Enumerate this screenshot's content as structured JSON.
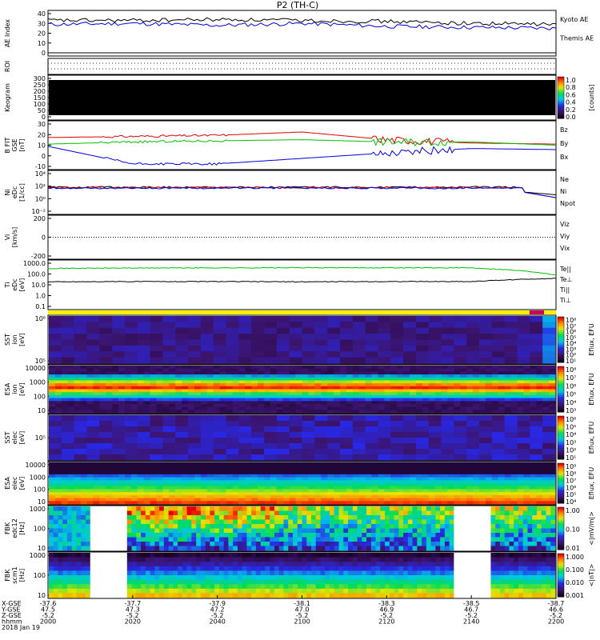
{
  "title": "P2 (TH-C)",
  "colors": {
    "blue": "#0000dd",
    "red": "#dd0000",
    "green": "#00c000",
    "black": "#000000",
    "yellow": "#ffee00",
    "magenta": "#cc0055",
    "purple_bg": "#2a0a4a"
  },
  "panels": [
    {
      "id": "ae",
      "ylabel": "AE Index",
      "yticks": [
        "40",
        "30",
        "20",
        "10",
        "0"
      ],
      "legend": [
        {
          "text": "Kyoto AE",
          "color": "#0000dd"
        },
        {
          "text": "Themis AE",
          "color": "#000000"
        }
      ]
    },
    {
      "id": "roi",
      "ylabel": "ROI",
      "yticks": []
    },
    {
      "id": "keogram",
      "ylabel": "Keogram",
      "yticks": [
        "300",
        "250",
        "200",
        "150",
        "100",
        "50",
        "0"
      ],
      "colorbar": {
        "label": "[counts]",
        "ticks": [
          "1.0",
          "0.8",
          "0.6",
          "0.4",
          "0.2",
          "0.0"
        ]
      }
    },
    {
      "id": "bfgm",
      "ylabel": [
        "B FIT",
        "GSE",
        "[nT]"
      ],
      "yticks": [
        "30",
        "20",
        "10",
        "0",
        "-10"
      ],
      "legend": [
        {
          "text": "Bz",
          "color": "#dd0000"
        },
        {
          "text": "By",
          "color": "#00c000"
        },
        {
          "text": "Bx",
          "color": "#0000dd"
        }
      ]
    },
    {
      "id": "density",
      "ylabel": [
        "Ni",
        "eDc",
        "[1/cc]"
      ],
      "yticks": [
        "10⁴",
        "10²",
        "10⁰",
        "10⁻²"
      ],
      "legend": [
        {
          "text": "Ne",
          "color": "#dd0000"
        },
        {
          "text": "Ni",
          "color": "#000000"
        },
        {
          "text": "Npot",
          "color": "#0000dd"
        }
      ]
    },
    {
      "id": "velocity",
      "ylabel": [
        "Vi",
        "[km/s]"
      ],
      "yticks": [
        "200",
        "0",
        "-200"
      ],
      "legend": [
        {
          "text": "Viz",
          "color": "#dd0000"
        },
        {
          "text": "Viy",
          "color": "#00c000"
        },
        {
          "text": "Vix",
          "color": "#0000dd"
        }
      ]
    },
    {
      "id": "temperature",
      "ylabel": [
        "Ti",
        "eDc",
        "[eV]"
      ],
      "yticks": [
        "1000.0",
        "100.0",
        "10.0",
        "1.0",
        "0.1"
      ],
      "legend": [
        {
          "text": "Te||",
          "color": "#000000"
        },
        {
          "text": "Te⊥",
          "color": "#dd0000"
        },
        {
          "text": "Ti||",
          "color": "#00c000"
        },
        {
          "text": "Ti⊥",
          "color": "#0000dd"
        }
      ]
    },
    {
      "id": "sst_ion",
      "ylabel": [
        "SST",
        "ion",
        "[eV]"
      ],
      "yticks": [
        "10⁶",
        "10⁵"
      ],
      "colorbar": {
        "label": "Eflux, EFU",
        "ticks": [
          "10⁸",
          "10⁷",
          "10⁶",
          "10⁵",
          "10⁴",
          "10³",
          "10²",
          "10¹"
        ]
      }
    },
    {
      "id": "esa_ion",
      "ylabel": [
        "ESA",
        "ion",
        "[eV]"
      ],
      "yticks": [
        "10000",
        "1000",
        "100",
        "10"
      ],
      "colorbar": {
        "label": "Eflux, EFU",
        "ticks": [
          "10⁸",
          "10⁷",
          "10⁶",
          "10⁵",
          "10⁴",
          "10³"
        ]
      }
    },
    {
      "id": "sst_elec",
      "ylabel": [
        "SST",
        "elec",
        "[eV]"
      ],
      "yticks": [
        "10⁵"
      ],
      "colorbar": {
        "label": "Eflux, EFU",
        "ticks": [
          "10⁶",
          "10⁵",
          "10⁴",
          "10³",
          "10²",
          "10¹"
        ]
      }
    },
    {
      "id": "esa_elec",
      "ylabel": [
        "ESA",
        "elec",
        "[eV]"
      ],
      "yticks": [
        "10000",
        "1000",
        "100",
        "10"
      ],
      "colorbar": {
        "label": "Eflux, EFU",
        "ticks": [
          "10⁹",
          "10⁸",
          "10⁷",
          "10⁶",
          "10⁵",
          "10⁴"
        ]
      }
    },
    {
      "id": "fbk_edc12",
      "ylabel": [
        "FBK",
        "edc12",
        "[Hz]"
      ],
      "yticks": [
        "1000",
        "100",
        "10"
      ],
      "colorbar": {
        "label": "<|mV/m|>",
        "ticks": [
          "1.00",
          "0.10",
          "0.01"
        ]
      }
    },
    {
      "id": "fbk_scm1",
      "ylabel": [
        "FBK",
        "scm1",
        "[Hz]"
      ],
      "yticks": [
        "1000",
        "100",
        "10"
      ],
      "colorbar": {
        "label": "<|nT|>",
        "ticks": [
          "1.000",
          "0.100",
          "0.010",
          "0.001"
        ]
      }
    }
  ],
  "xaxis": {
    "row_labels": [
      "X-GSE",
      "Y-GSE",
      "Z-GSE",
      "hhmm",
      "2018 Jan 19"
    ],
    "ticks": [
      {
        "x": "-37.6",
        "y": "47.5",
        "z": "-5.2",
        "t": "2000"
      },
      {
        "x": "-37.7",
        "y": "47.3",
        "z": "-5.2",
        "t": "2020"
      },
      {
        "x": "-37.9",
        "y": "47.2",
        "z": "-5.2",
        "t": "2040"
      },
      {
        "x": "-38.1",
        "y": "47.0",
        "z": "-5.2",
        "t": "2100"
      },
      {
        "x": "-38.3",
        "y": "46.9",
        "z": "-5.2",
        "t": "2120"
      },
      {
        "x": "-38.5",
        "y": "46.7",
        "z": "-5.2",
        "t": "2140"
      },
      {
        "x": "-38.7",
        "y": "46.6",
        "z": "-5.2",
        "t": "2200"
      }
    ]
  },
  "chart_data": [
    {
      "type": "line",
      "panel": "ae",
      "ylabel": "AE Index",
      "ylim": [
        0,
        40
      ],
      "x": [
        "2000",
        "2020",
        "2040",
        "2100",
        "2120",
        "2140",
        "2200"
      ],
      "series": [
        {
          "name": "Kyoto AE",
          "color": "#0000dd",
          "values": [
            29,
            30,
            28,
            30,
            27,
            26,
            25
          ]
        },
        {
          "name": "Themis AE",
          "color": "#000000",
          "values": [
            33,
            33,
            34,
            33,
            32,
            30,
            29
          ]
        }
      ]
    },
    {
      "type": "line",
      "panel": "bfgm",
      "ylabel": "B FIT GSE [nT]",
      "ylim": [
        -10,
        30
      ],
      "x": [
        "2000",
        "2020",
        "2040",
        "2100",
        "2120",
        "2140",
        "2200"
      ],
      "series": [
        {
          "name": "Bz",
          "color": "#dd0000",
          "values": [
            17,
            18,
            19,
            22,
            15,
            12,
            11
          ]
        },
        {
          "name": "By",
          "color": "#00c000",
          "values": [
            11,
            13,
            14,
            15,
            13,
            13,
            10
          ]
        },
        {
          "name": "Bx",
          "color": "#0000dd",
          "values": [
            9,
            -7,
            -7,
            -2,
            3,
            7,
            6
          ]
        }
      ]
    },
    {
      "type": "line",
      "panel": "temperature",
      "ylabel": "Ti eDc [eV]",
      "ylim": [
        0.1,
        1000
      ],
      "x": [
        "2000",
        "2020",
        "2040",
        "2100",
        "2120",
        "2140",
        "2200"
      ],
      "series": [
        {
          "name": "Ti||",
          "color": "#00c000",
          "values": [
            330,
            360,
            370,
            380,
            380,
            370,
            80
          ]
        },
        {
          "name": "Te||",
          "color": "#000000",
          "values": [
            19,
            20,
            20,
            19,
            20,
            20,
            40
          ]
        }
      ]
    }
  ]
}
